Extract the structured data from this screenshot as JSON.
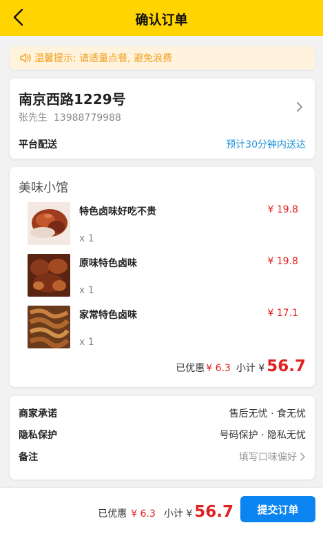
{
  "header": {
    "title": "确认订单"
  },
  "notice": {
    "text": "温馨提示: 请适量点餐, 避免浪费"
  },
  "address": {
    "line": "南京西路1229号",
    "contact": "张先生  13988779988",
    "delivery_label": "平台配送",
    "delivery_time": "预计30分钟内送达"
  },
  "order": {
    "shop_name": "美味小馆",
    "items": [
      {
        "name": "特色卤味好吃不贵",
        "price": "¥ 19.8",
        "qty": "x 1"
      },
      {
        "name": "原味特色卤味",
        "price": "¥ 19.8",
        "qty": "x 1"
      },
      {
        "name": "家常特色卤味",
        "price": "¥ 17.1",
        "qty": "x 1"
      }
    ],
    "discount_label": "已优惠",
    "discount_value": "¥ 6.3",
    "subtotal_label": "小计 ¥",
    "subtotal_value": "56.7"
  },
  "info": {
    "promise_label": "商家承诺",
    "promise_value": "售后无忧 · 食无忧",
    "privacy_label": "隐私保护",
    "privacy_value": "号码保护 · 隐私无忧",
    "note_label": "备注",
    "note_value": "填写口味偏好"
  },
  "bottom": {
    "discount_label": "已优惠",
    "discount_value": "¥ 6.3",
    "subtotal_label": "小计 ¥",
    "subtotal_value": "56.7",
    "submit_label": "提交订单"
  },
  "colors": {
    "header_bg": "#ffd400",
    "price_red": "#e02020",
    "link_blue": "#1a8fd8",
    "button_blue": "#0a84f0",
    "notice_orange": "#f0a020"
  },
  "icons": [
    "back-arrow-icon",
    "speaker-icon",
    "chevron-right-icon",
    "food-thumbnail"
  ]
}
